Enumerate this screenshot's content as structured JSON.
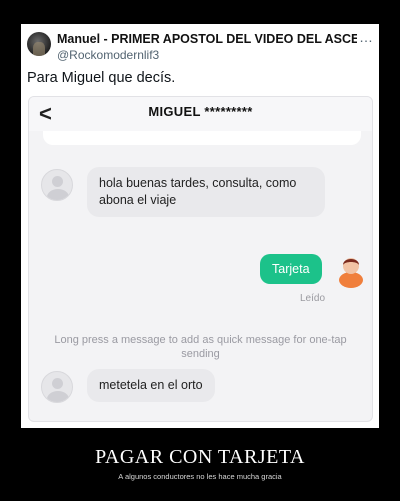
{
  "tweet": {
    "user_name": "Manuel - PRIMER APOSTOL DEL VIDEO DEL ASCEN",
    "handle": "@Rockomodernlif3",
    "more_icon": "…",
    "text": "Para Miguel que decís."
  },
  "chat": {
    "back_icon": "chevron-left-icon",
    "back_glyph": "<",
    "title": "MIGUEL *********",
    "messages": [
      {
        "from": "driver",
        "text_line1": "hola buenas tardes, consulta, como",
        "text_line2": "abona el viaje"
      },
      {
        "from": "user",
        "text": "Tarjeta",
        "status": "Leído"
      },
      {
        "from": "driver",
        "text": "metetela en el orto"
      }
    ],
    "hint_line1": "Long press a message to add as quick message for one-tap",
    "hint_line2": "sending",
    "colors": {
      "outgoing_bubble": "#1cc28a",
      "incoming_bubble": "#e9e9ec"
    }
  },
  "caption": {
    "title": "PAGAR CON TARJETA",
    "subtitle": "A algunos conductores no les hace mucha gracia"
  }
}
